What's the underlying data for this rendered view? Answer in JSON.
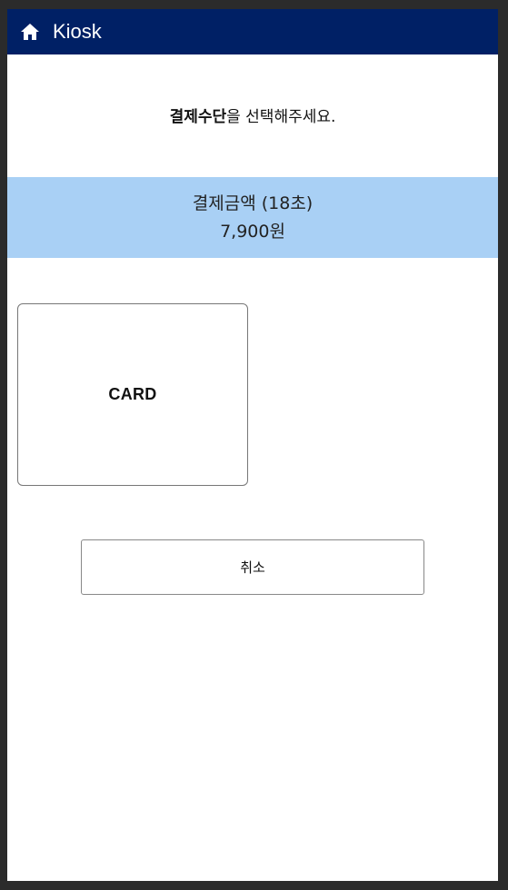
{
  "header": {
    "icon": "home-icon",
    "title": "Kiosk",
    "background": "#002065"
  },
  "prompt": {
    "bold_part": "결제수단",
    "rest": "을 선택해주세요."
  },
  "payment": {
    "label": "결제금액 (18초)",
    "amount": "7,900원",
    "background": "#a9d0f5"
  },
  "methods": [
    {
      "label": "CARD"
    }
  ],
  "actions": {
    "cancel_label": "취소"
  }
}
